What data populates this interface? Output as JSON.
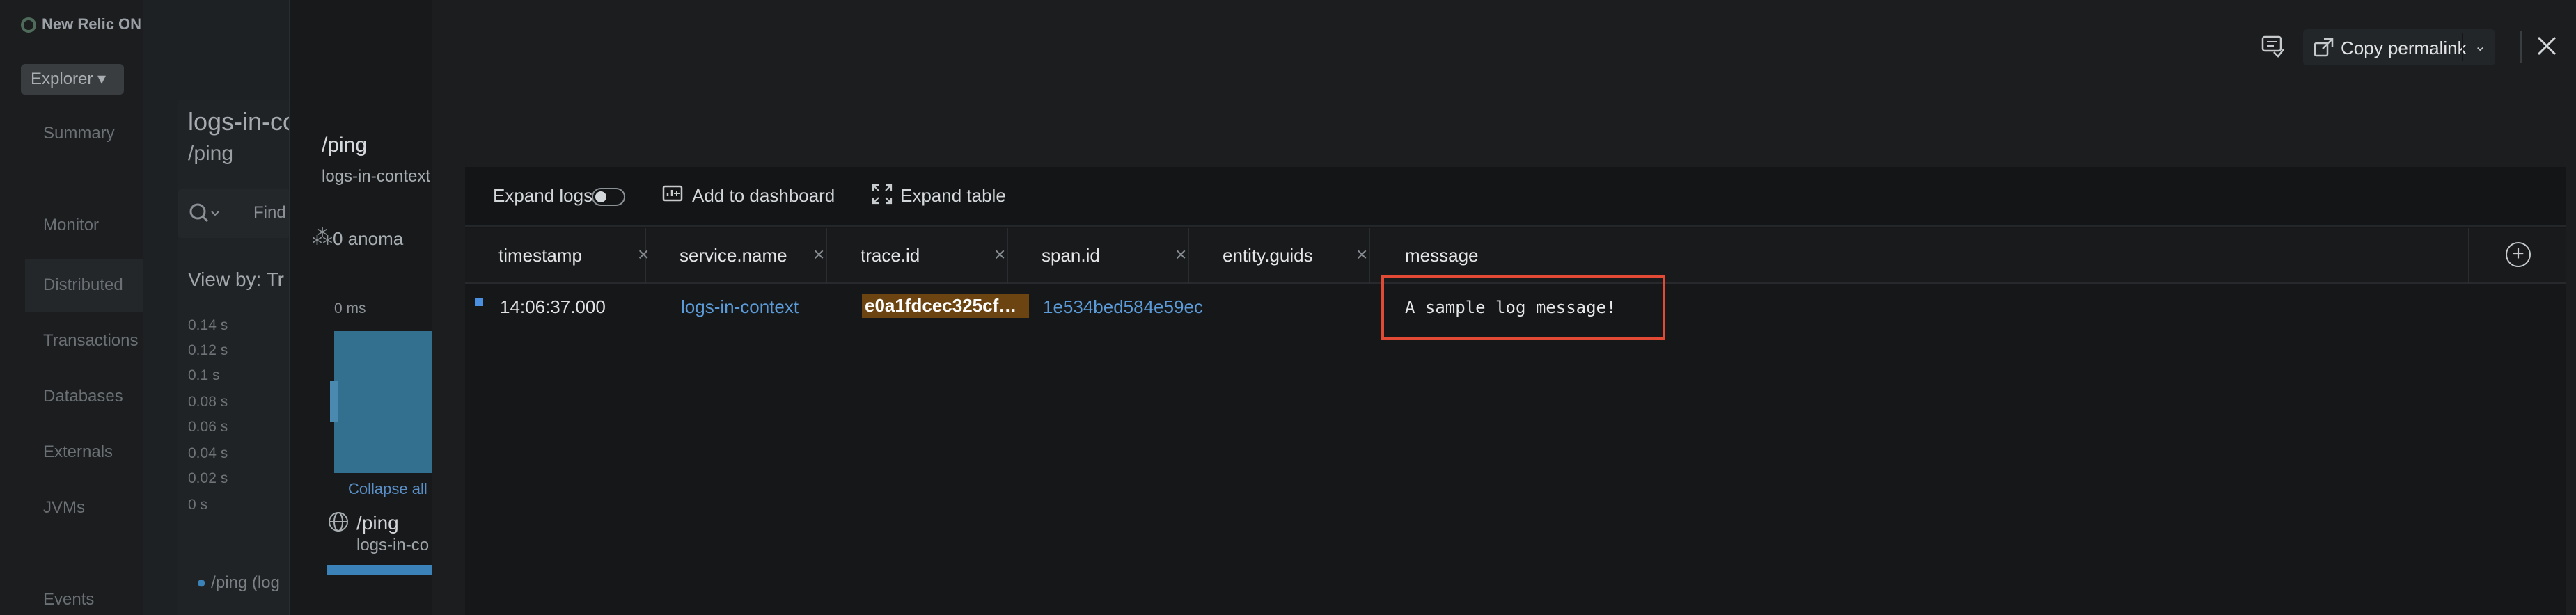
{
  "background_app": {
    "brand": "New Relic ON",
    "explorer_label": "Explorer",
    "nav": [
      "Summary",
      "Monitor",
      "Distributed",
      "Transactions",
      "Databases",
      "Externals",
      "JVMs",
      "Events"
    ],
    "entity_title": "logs-in-con",
    "entity_sub": "/ping",
    "search_label": "Find",
    "view_by": "View by: Tr",
    "y_axis": [
      "0.14 s",
      "0.12 s",
      "0.1 s",
      "0.08 s",
      "0.06 s",
      "0.04 s",
      "0.02 s",
      "0 s"
    ],
    "legend": "/ping (log"
  },
  "trace_drawer": {
    "title": "/ping",
    "service": "logs-in-context",
    "anomalies": "0 anoma",
    "timeline_start": "0 ms",
    "collapse_all": "Collapse all",
    "span_name": "/ping",
    "span_service": "logs-in-co"
  },
  "header_actions": {
    "copy_permalink": "Copy permalink"
  },
  "logs": {
    "toolbar": {
      "expand_logs": "Expand logs",
      "expand_logs_on": false,
      "add_to_dashboard": "Add to dashboard",
      "expand_table": "Expand table"
    },
    "columns": [
      "timestamp",
      "service.name",
      "trace.id",
      "span.id",
      "entity.guids",
      "message"
    ],
    "rows": [
      {
        "timestamp": "14:06:37.000",
        "service": "logs-in-context",
        "trace_id": "e0a1fdcec325cfa6…",
        "span_id": "1e534bed584e59ec",
        "entity_guids": "",
        "message": "A sample log message!"
      }
    ]
  },
  "colors": {
    "link": "#5b9bd9",
    "trace_highlight": "#6b4412",
    "annotation_box": "#e24a35"
  }
}
